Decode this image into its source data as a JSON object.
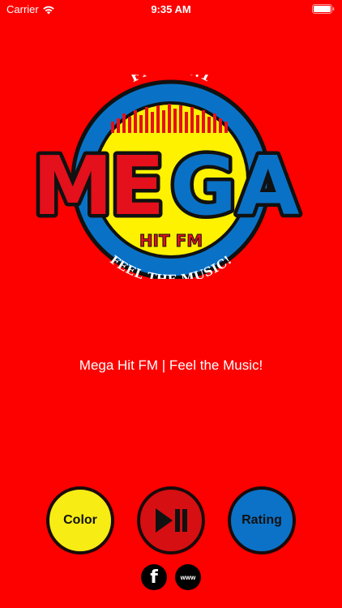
{
  "status_bar": {
    "carrier": "Carrier",
    "time": "9:35 AM"
  },
  "logo": {
    "frequency": "FM 101.1",
    "name": "MEGA",
    "subtitle": "HIT FM",
    "slogan": "FEEL THE MUSIC!",
    "colors": {
      "red": "#e4101b",
      "blue": "#0a72c6",
      "yellow": "#fef200",
      "outline": "#111111"
    }
  },
  "tagline": "Mega Hit FM | Feel the Music!",
  "buttons": {
    "color_label": "Color",
    "play_icon": "play-pause-icon",
    "rating_label": "Rating"
  },
  "social": {
    "facebook_glyph": "f",
    "website_label": "www"
  },
  "theme": {
    "background": "#fd0000"
  }
}
